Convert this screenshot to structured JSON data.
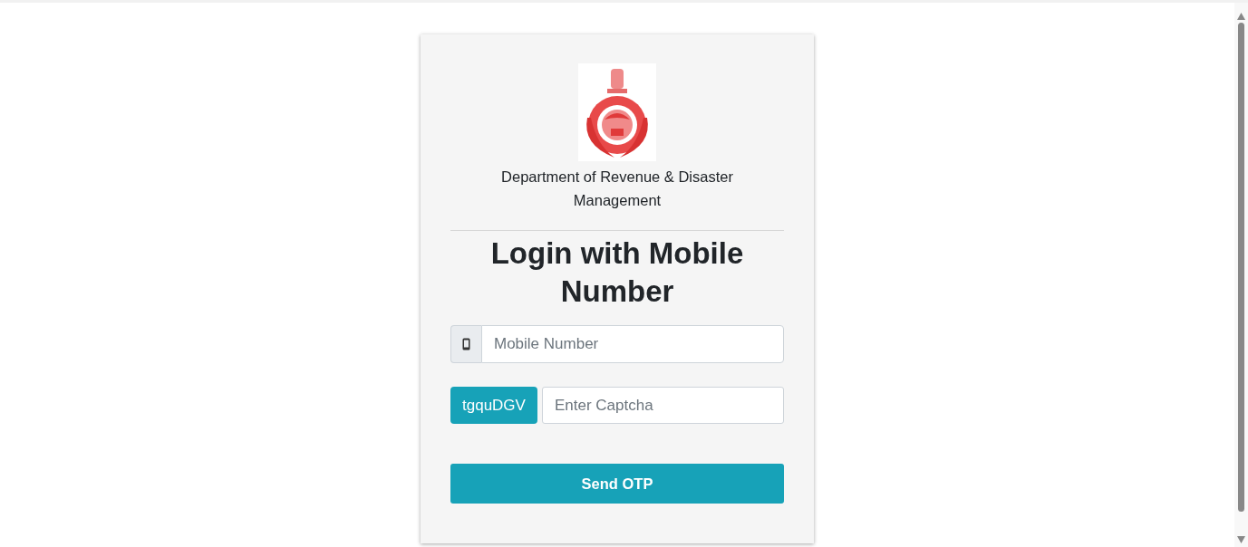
{
  "login_card": {
    "department": "Department of Revenue & Disaster Management",
    "heading": "Login with Mobile Number",
    "mobile_field": {
      "placeholder": "Mobile Number"
    },
    "captcha": {
      "code": "tgquDGV",
      "placeholder": "Enter Captcha"
    },
    "submit_button": "Send OTP"
  }
}
